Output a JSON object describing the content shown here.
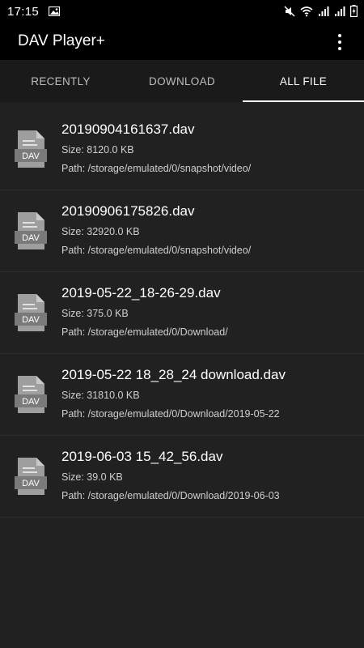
{
  "status": {
    "time": "17:15",
    "battery_icon": "battery-icon",
    "wifi_icon": "wifi-icon"
  },
  "app": {
    "title": "DAV Player+"
  },
  "tabs": [
    {
      "label": "RECENTLY",
      "active": false
    },
    {
      "label": "DOWNLOAD",
      "active": false
    },
    {
      "label": "ALL FILE",
      "active": true
    }
  ],
  "files": [
    {
      "name": "20190904161637.dav",
      "size": "Size: 8120.0 KB",
      "path": "Path: /storage/emulated/0/snapshot/video/"
    },
    {
      "name": "20190906175826.dav",
      "size": "Size: 32920.0 KB",
      "path": "Path: /storage/emulated/0/snapshot/video/"
    },
    {
      "name": "2019-05-22_18-26-29.dav",
      "size": "Size: 375.0 KB",
      "path": "Path: /storage/emulated/0/Download/"
    },
    {
      "name": "2019-05-22 18_28_24 download.dav",
      "size": "Size: 31810.0 KB",
      "path": "Path: /storage/emulated/0/Download/2019-05-22"
    },
    {
      "name": "2019-06-03 15_42_56.dav",
      "size": "Size: 39.0 KB",
      "path": "Path: /storage/emulated/0/Download/2019-06-03"
    }
  ],
  "file_icon_label": "DAV",
  "colors": {
    "background": "#212121",
    "bar": "#000000",
    "icon": "#9e9e9e"
  }
}
